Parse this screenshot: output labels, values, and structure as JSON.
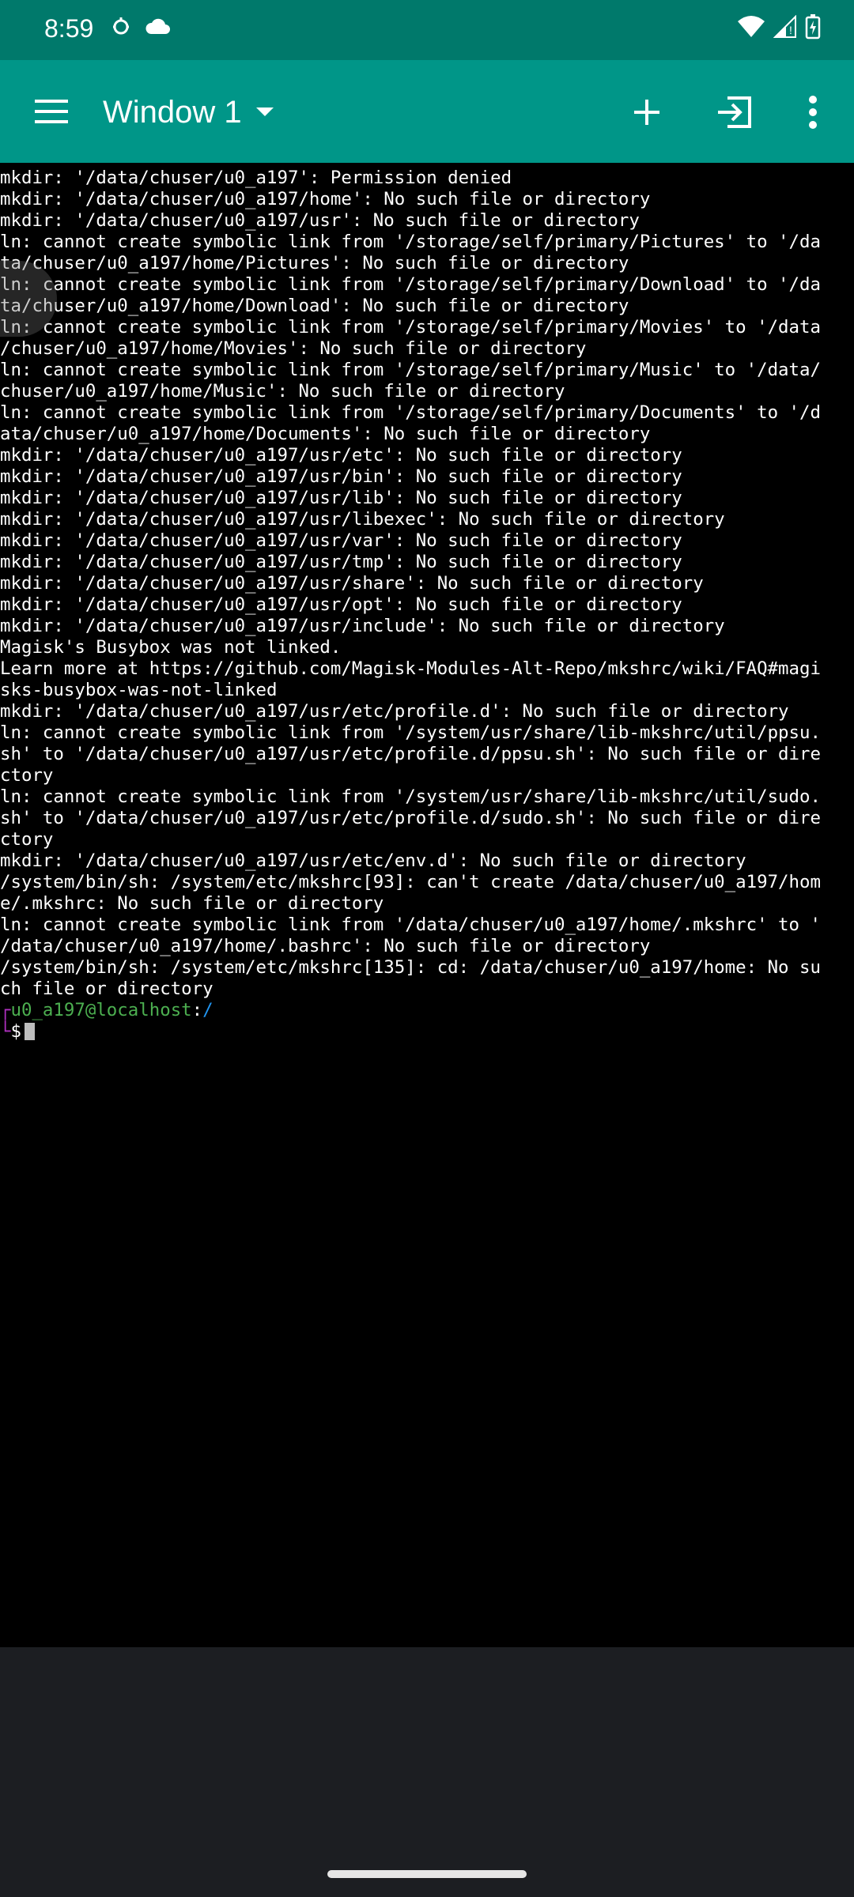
{
  "status_bar": {
    "time": "8:59",
    "left_icons": [
      "android-debug-icon",
      "cloud-icon"
    ],
    "right_icons": [
      "wifi-icon",
      "signal-icon",
      "battery-charging-icon"
    ]
  },
  "app_bar": {
    "title": "Window 1",
    "actions": [
      "add-icon",
      "exit-icon",
      "more-vert-icon"
    ]
  },
  "terminal": {
    "lines": [
      "mkdir: '/data/chuser/u0_a197': Permission denied",
      "mkdir: '/data/chuser/u0_a197/home': No such file or directory",
      "mkdir: '/data/chuser/u0_a197/usr': No such file or directory",
      "ln: cannot create symbolic link from '/storage/self/primary/Pictures' to '/da",
      "ta/chuser/u0_a197/home/Pictures': No such file or directory",
      "ln: cannot create symbolic link from '/storage/self/primary/Download' to '/da",
      "ta/chuser/u0_a197/home/Download': No such file or directory",
      "ln: cannot create symbolic link from '/storage/self/primary/Movies' to '/data",
      "/chuser/u0_a197/home/Movies': No such file or directory",
      "ln: cannot create symbolic link from '/storage/self/primary/Music' to '/data/",
      "chuser/u0_a197/home/Music': No such file or directory",
      "ln: cannot create symbolic link from '/storage/self/primary/Documents' to '/d",
      "ata/chuser/u0_a197/home/Documents': No such file or directory",
      "mkdir: '/data/chuser/u0_a197/usr/etc': No such file or directory",
      "mkdir: '/data/chuser/u0_a197/usr/bin': No such file or directory",
      "mkdir: '/data/chuser/u0_a197/usr/lib': No such file or directory",
      "mkdir: '/data/chuser/u0_a197/usr/libexec': No such file or directory",
      "mkdir: '/data/chuser/u0_a197/usr/var': No such file or directory",
      "mkdir: '/data/chuser/u0_a197/usr/tmp': No such file or directory",
      "mkdir: '/data/chuser/u0_a197/usr/share': No such file or directory",
      "mkdir: '/data/chuser/u0_a197/usr/opt': No such file or directory",
      "mkdir: '/data/chuser/u0_a197/usr/include': No such file or directory",
      "Magisk's Busybox was not linked.",
      "Learn more at https://github.com/Magisk-Modules-Alt-Repo/mkshrc/wiki/FAQ#magi",
      "sks-busybox-was-not-linked",
      "mkdir: '/data/chuser/u0_a197/usr/etc/profile.d': No such file or directory",
      "ln: cannot create symbolic link from '/system/usr/share/lib-mkshrc/util/ppsu.",
      "sh' to '/data/chuser/u0_a197/usr/etc/profile.d/ppsu.sh': No such file or dire",
      "ctory",
      "ln: cannot create symbolic link from '/system/usr/share/lib-mkshrc/util/sudo.",
      "sh' to '/data/chuser/u0_a197/usr/etc/profile.d/sudo.sh': No such file or dire",
      "ctory",
      "mkdir: '/data/chuser/u0_a197/usr/etc/env.d': No such file or directory",
      "/system/bin/sh: /system/etc/mkshrc[93]: can't create /data/chuser/u0_a197/hom",
      "e/.mkshrc: No such file or directory",
      "ln: cannot create symbolic link from '/data/chuser/u0_a197/home/.mkshrc' to '",
      "/data/chuser/u0_a197/home/.bashrc': No such file or directory",
      "/system/bin/sh: /system/etc/mkshrc[135]: cd: /data/chuser/u0_a197/home: No su",
      "ch file or directory"
    ],
    "prompt": {
      "corner_top": "┌",
      "user_host": "u0_a197@localhost",
      "colon": ":",
      "path": "/",
      "corner_bottom": "└",
      "symbol": "$"
    },
    "colors": {
      "user": "#4caf50",
      "path": "#2196f3",
      "bracket": "#b030c0"
    }
  },
  "colors": {
    "status_bar": "#00796b",
    "app_bar": "#009688",
    "terminal_bg": "#000000",
    "bottom_area": "#1c1e22"
  }
}
